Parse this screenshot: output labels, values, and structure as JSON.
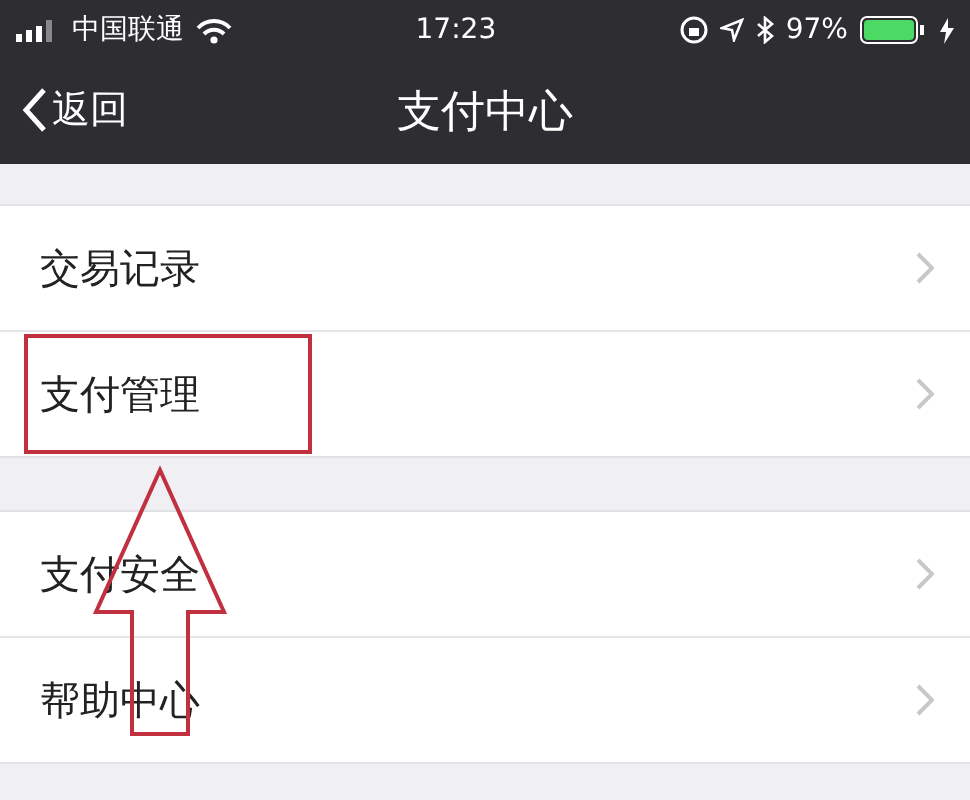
{
  "status_bar": {
    "carrier": "中国联通",
    "time": "17:23",
    "battery": "97%"
  },
  "nav": {
    "back": "返回",
    "title": "支付中心"
  },
  "groups": [
    {
      "items": [
        {
          "label": "交易记录",
          "highlighted": false
        },
        {
          "label": "支付管理",
          "highlighted": true
        }
      ]
    },
    {
      "items": [
        {
          "label": "支付安全",
          "highlighted": false
        },
        {
          "label": "帮助中心",
          "highlighted": false
        }
      ]
    }
  ]
}
